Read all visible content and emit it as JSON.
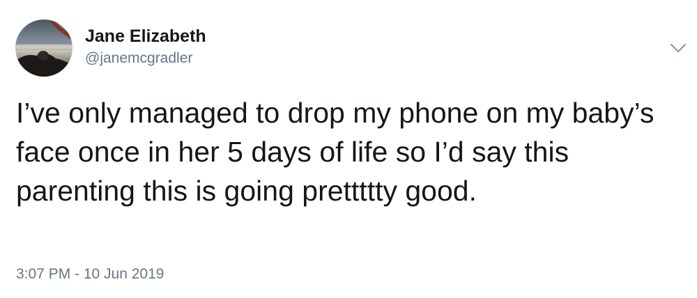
{
  "tweet": {
    "author": {
      "display_name": "Jane Elizabeth",
      "handle": "@janemcgradler",
      "avatar_icon": "profile-photo"
    },
    "text": "I’ve only managed to drop my phone on my baby’s face once in her 5 days of life so I’d say this parenting this is going prettttty good.",
    "timestamp": "3:07 PM - 10 Jun 2019",
    "menu_icon": "chevron-down-icon"
  },
  "colors": {
    "text_primary": "#14171a",
    "text_secondary": "#657786",
    "icon": "#8899a6",
    "background": "#ffffff"
  }
}
